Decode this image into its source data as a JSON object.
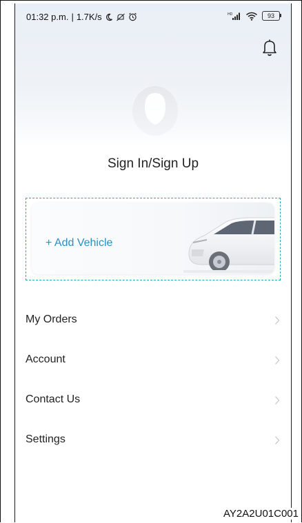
{
  "status_bar": {
    "time": "01:32 p.m.",
    "speed": "1.7K/s",
    "battery": "93"
  },
  "profile": {
    "sign_in_label": "Sign In/Sign Up"
  },
  "vehicle": {
    "add_label": "+ Add Vehicle"
  },
  "menu": {
    "items": [
      {
        "label": "My Orders"
      },
      {
        "label": "Account"
      },
      {
        "label": "Contact Us"
      },
      {
        "label": "Settings"
      }
    ]
  },
  "footer": {
    "page_code": "AY2A2U01C001"
  },
  "colors": {
    "accent": "#26a7b2",
    "link": "#2d8fbd",
    "text": "#222222",
    "chevron": "#c8c8c8"
  },
  "icons": [
    "moon-icon",
    "notification-muted-icon",
    "alarm-icon",
    "cellular-signal-icon",
    "wifi-icon",
    "battery-icon",
    "bell-icon",
    "avatar-placeholder-icon",
    "car-icon",
    "chevron-right-icon"
  ]
}
